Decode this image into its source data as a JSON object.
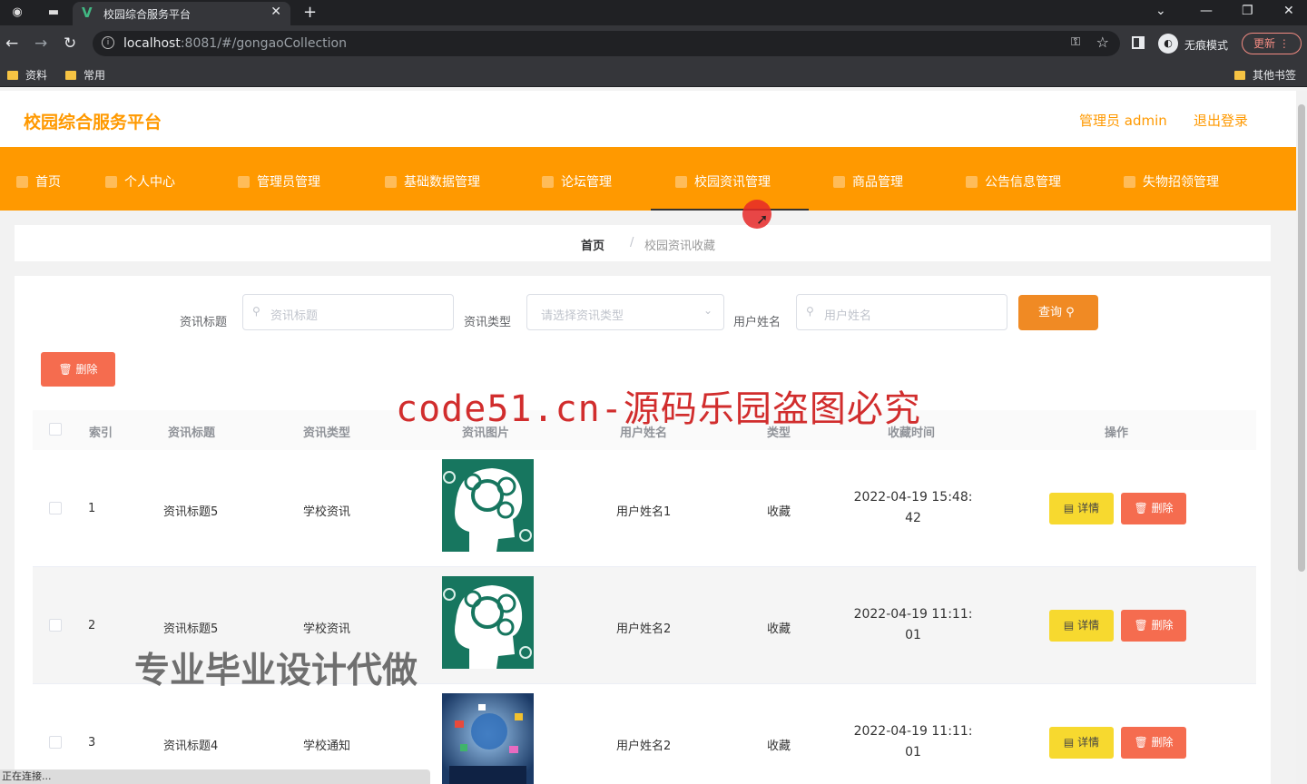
{
  "browser": {
    "tab_title": "校园综合服务平台",
    "url_host": "localhost",
    "url_rest": ":8081/#/gongaoCollection",
    "incognito_label": "无痕模式",
    "update_label": "更新",
    "bookmarks": [
      "资料",
      "常用"
    ],
    "other_bookmarks": "其他书签"
  },
  "header": {
    "brand": "校园综合服务平台",
    "admin": "管理员 admin",
    "logout": "退出登录"
  },
  "menu": {
    "items": [
      "首页",
      "个人中心",
      "管理员管理",
      "基础数据管理",
      "论坛管理",
      "校园资讯管理",
      "商品管理",
      "公告信息管理",
      "失物招领管理"
    ],
    "active": "校园资讯管理"
  },
  "breadcrumb": {
    "home": "首页",
    "separator": "/",
    "current": "校园资讯收藏"
  },
  "search": {
    "title_label": "资讯标题",
    "title_placeholder": "资讯标题",
    "type_label": "资讯类型",
    "type_placeholder": "请选择资讯类型",
    "user_label": "用户姓名",
    "user_placeholder": "用户姓名",
    "query_button": "查询"
  },
  "batch_delete": "删除",
  "table": {
    "headers": [
      "索引",
      "资讯标题",
      "资讯类型",
      "资讯图片",
      "用户姓名",
      "类型",
      "收藏时间",
      "操作"
    ],
    "rows": [
      {
        "index": "1",
        "title": "资讯标题5",
        "type": "学校资讯",
        "user": "用户姓名1",
        "kind": "收藏",
        "time1": "2022-04-19 15:48:",
        "time2": "42"
      },
      {
        "index": "2",
        "title": "资讯标题5",
        "type": "学校资讯",
        "user": "用户姓名2",
        "kind": "收藏",
        "time1": "2022-04-19 11:11:",
        "time2": "01"
      },
      {
        "index": "3",
        "title": "资讯标题4",
        "type": "学校通知",
        "user": "用户姓名2",
        "kind": "收藏",
        "time1": "2022-04-19 11:11:",
        "time2": "01"
      }
    ],
    "detail_button": "详情",
    "delete_button": "删除"
  },
  "overlay": {
    "watermark": "code51.cn-源码乐园盗图必究",
    "promo": "专业毕业设计代做"
  },
  "status_text": "正在连接...",
  "colors": {
    "accent": "#ff9900",
    "danger": "#f56c4f",
    "warning": "#f7d92f"
  }
}
